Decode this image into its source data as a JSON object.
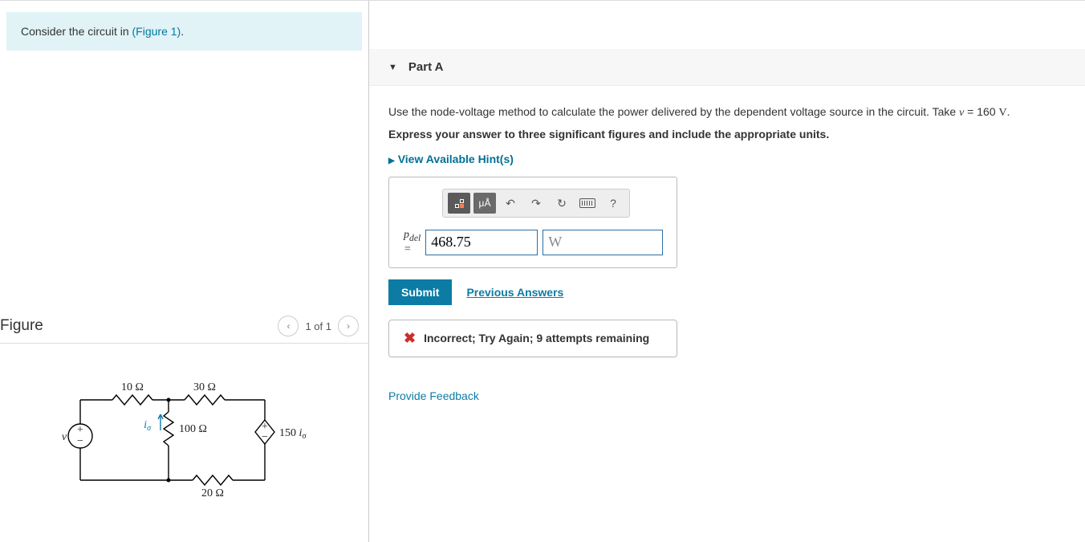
{
  "prompt": {
    "prefix": "Consider the circuit in ",
    "link": "(Figure 1)",
    "suffix": "."
  },
  "figure": {
    "title": "Figure",
    "pager": "1 of 1"
  },
  "circuit": {
    "r_top_left": "10 Ω",
    "r_top_right": "30 Ω",
    "r_mid": "100 Ω",
    "r_bottom": "20 Ω",
    "v_source": "v",
    "i_label": "iσ",
    "dep_source": "150 iσ"
  },
  "part": {
    "label": "Part A",
    "instruction_prefix": "Use the node-voltage method to calculate the power delivered by the dependent voltage source in the circuit. Take ",
    "instruction_var": "v",
    "instruction_eq": " = 160 ",
    "instruction_unit": "V",
    "instruction_suffix": ".",
    "express": "Express your answer to three significant figures and include the appropriate units.",
    "hints": "View Available Hint(s)"
  },
  "toolbar": {
    "templates_title": "Templates",
    "symbols_title": "μÅ",
    "undo_title": "Undo",
    "redo_title": "Redo",
    "reset_title": "Reset",
    "keyboard_title": "Keyboard",
    "help_title": "?"
  },
  "answer": {
    "label": "pdel =",
    "value": "468.75",
    "units": "W"
  },
  "actions": {
    "submit": "Submit",
    "previous": "Previous Answers"
  },
  "feedback": {
    "text": "Incorrect; Try Again; 9 attempts remaining"
  },
  "links": {
    "provide_feedback": "Provide Feedback"
  }
}
